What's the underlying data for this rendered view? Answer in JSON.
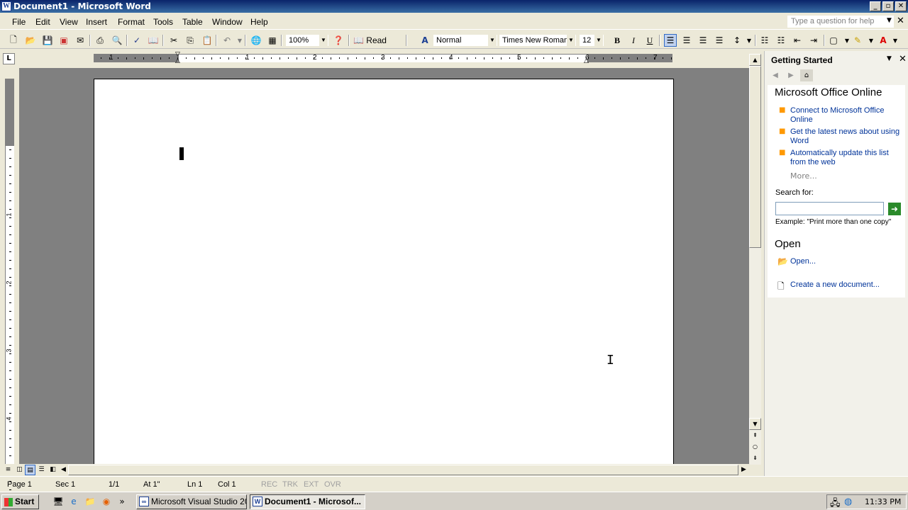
{
  "window": {
    "title": "Document1 - Microsoft Word",
    "app_icon": "W",
    "min": "_",
    "max": "▫",
    "close": "✕"
  },
  "menu": [
    "File",
    "Edit",
    "View",
    "Insert",
    "Format",
    "Tools",
    "Table",
    "Window",
    "Help"
  ],
  "help_box": {
    "placeholder": "Type a question for help"
  },
  "toolbar": {
    "zoom": "100%",
    "read_label": "Read",
    "style": "Normal",
    "font": "Times New Roman",
    "size": "12",
    "bold": "B",
    "italic": "I",
    "underline": "U"
  },
  "ruler": {
    "numbers": [
      "1",
      "1",
      "2",
      "3",
      "4",
      "5",
      "6",
      "7"
    ],
    "vnumbers": [
      "1",
      "2",
      "3",
      "4"
    ],
    "corner": "L"
  },
  "task_pane": {
    "title": "Getting Started",
    "office_online_title": "Microsoft Office Online",
    "links": [
      "Connect to Microsoft Office Online",
      "Get the latest news about using Word",
      "Automatically update this list from the web"
    ],
    "more": "More...",
    "search_label": "Search for:",
    "search_value": "",
    "example": "Example:  \"Print more than one copy\"",
    "open_title": "Open",
    "open_link": "Open...",
    "new_link": "Create a new document..."
  },
  "status": {
    "page": "Page 1",
    "sec": "Sec 1",
    "of": "1/1",
    "at": "At 1\"",
    "ln": "Ln 1",
    "col": "Col 1",
    "rec": "REC",
    "trk": "TRK",
    "ext": "EXT",
    "ovr": "OVR"
  },
  "taskbar": {
    "start": "Start",
    "items": [
      "Microsoft Visual Studio 20...",
      "Document1 - Microsof..."
    ],
    "clock": "11:33 PM"
  }
}
